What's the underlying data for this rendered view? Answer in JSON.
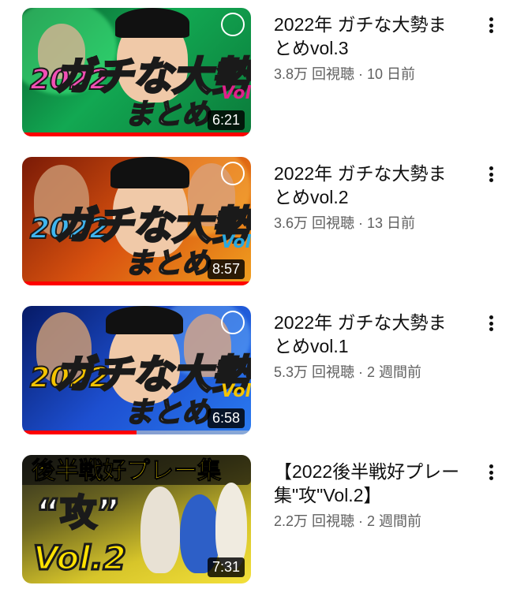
{
  "videos": [
    {
      "title": "2022年 ガチな大勢まとめvol.3",
      "views": "3.8万 回視聴",
      "age": "10 日前",
      "duration": "6:21",
      "progress": 1.0,
      "thumb_text": {
        "year": "2022",
        "main": "ガチな大勢",
        "sub": "まとめ",
        "vol": "Vol."
      },
      "colors": {
        "bg1": "#0a7a3c",
        "bg2": "#1fe06a",
        "accent": "#e0218a"
      }
    },
    {
      "title": "2022年 ガチな大勢まとめvol.2",
      "views": "3.6万 回視聴",
      "age": "13 日前",
      "duration": "8:57",
      "progress": 1.0,
      "thumb_text": {
        "year": "2022",
        "main": "ガチな大勢",
        "sub": "まとめ",
        "vol": "Vol."
      },
      "colors": {
        "bg1": "#b8320a",
        "bg2": "#f28a1c",
        "accent": "#29a9e0"
      }
    },
    {
      "title": "2022年 ガチな大勢まとめvol.1",
      "views": "5.3万 回視聴",
      "age": "2 週間前",
      "duration": "6:58",
      "progress": 0.5,
      "thumb_text": {
        "year": "2022",
        "main": "ガチな大勢",
        "sub": "まとめ",
        "vol": "Vol."
      },
      "colors": {
        "bg1": "#0b2a8a",
        "bg2": "#2d66e0",
        "accent": "#f5c400"
      }
    },
    {
      "title": "【2022後半戦好プレー集\"攻\"Vol.2】",
      "views": "2.2万 回視聴",
      "age": "2 週間前",
      "duration": "7:31",
      "progress": 0,
      "thumb_text": {
        "year": "後半戦好プレー集",
        "main": "“攻”",
        "sub": "Vol.2",
        "vol": ""
      },
      "colors": {
        "bg1": "#8a7a10",
        "bg2": "#f3e03a",
        "accent": "#1a1a1a"
      }
    }
  ]
}
